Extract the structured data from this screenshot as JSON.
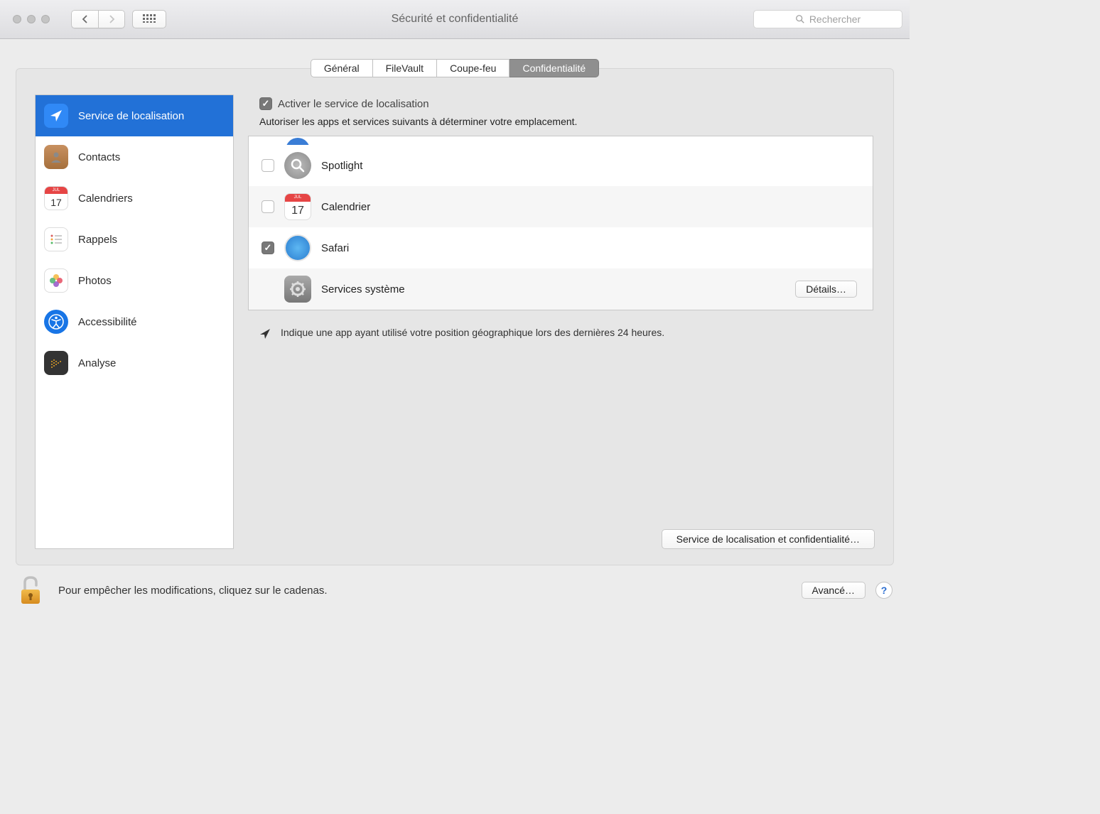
{
  "window": {
    "title": "Sécurité et confidentialité",
    "search_placeholder": "Rechercher"
  },
  "tabs": {
    "general": "Général",
    "filevault": "FileVault",
    "firewall": "Coupe-feu",
    "privacy": "Confidentialité"
  },
  "sidebar": {
    "items": [
      {
        "label": "Service de localisation"
      },
      {
        "label": "Contacts"
      },
      {
        "label": "Calendriers"
      },
      {
        "label": "Rappels"
      },
      {
        "label": "Photos"
      },
      {
        "label": "Accessibilité"
      },
      {
        "label": "Analyse"
      }
    ]
  },
  "content": {
    "enable_label": "Activer le service de localisation",
    "subtext": "Autoriser les apps et services suivants à déterminer votre emplacement.",
    "apps": [
      {
        "name": "Spotlight",
        "checked": false
      },
      {
        "name": "Calendrier",
        "checked": false
      },
      {
        "name": "Safari",
        "checked": true
      }
    ],
    "system_services": "Services système",
    "details_btn": "Détails…",
    "footnote": "Indique une app ayant utilisé votre position géographique lors des dernières 24 heures.",
    "privacy_btn": "Service de localisation et confidentialité…"
  },
  "lockbar": {
    "text": "Pour empêcher les modifications, cliquez sur le cadenas.",
    "advanced_btn": "Avancé…",
    "help": "?"
  }
}
